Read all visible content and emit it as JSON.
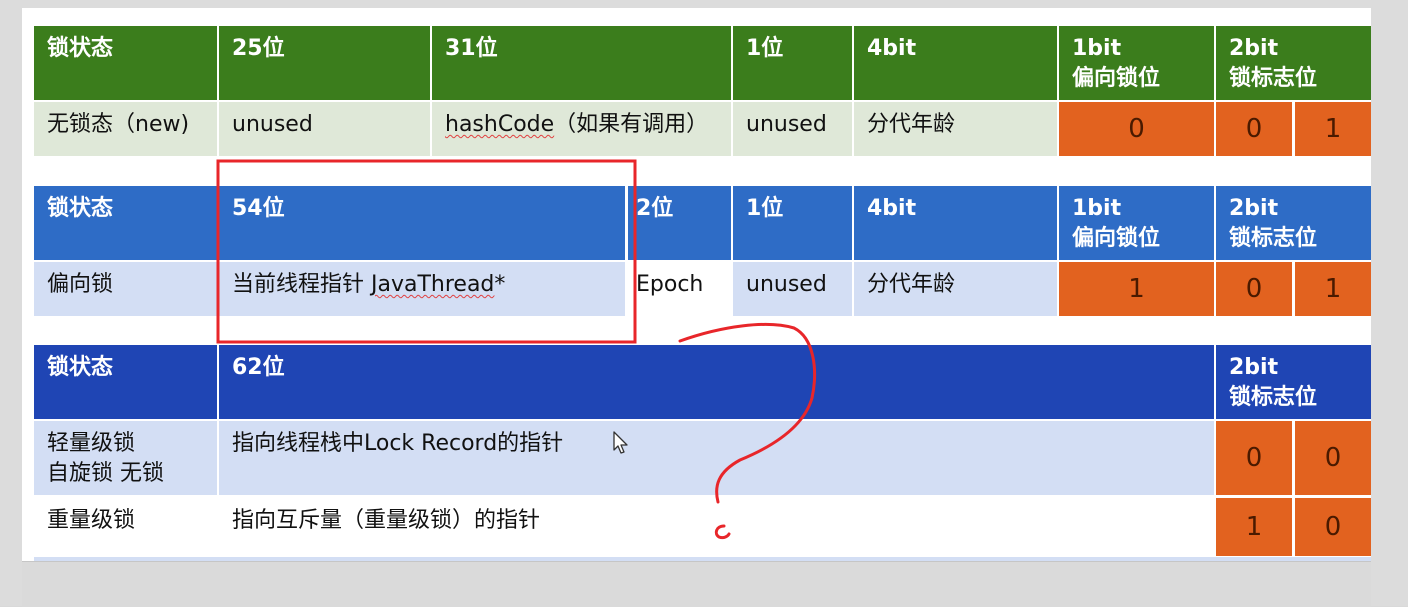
{
  "table1": {
    "header": [
      "锁状态",
      "25位",
      "31位",
      "1位",
      "4bit",
      "1bit\n偏向锁位",
      "2bit\n锁标志位"
    ],
    "row": {
      "state": "无锁态（new)",
      "c1": "unused",
      "c2_code": "hashCode",
      "c2_rest": "（如果有调用）",
      "c3": "unused",
      "c4": "分代年龄",
      "biased": "0",
      "flag1": "0",
      "flag2": "1"
    }
  },
  "table2": {
    "header": [
      "锁状态",
      "54位",
      "2位",
      "1位",
      "4bit",
      "1bit\n偏向锁位",
      "2bit\n锁标志位"
    ],
    "row": {
      "state": "偏向锁",
      "c1_pre": "当前线程指针 ",
      "c1_code": "JavaThread",
      "c1_post": "*",
      "c2": "Epoch",
      "c3": "unused",
      "c4": "分代年龄",
      "biased": "1",
      "flag1": "0",
      "flag2": "1"
    }
  },
  "table3": {
    "header": [
      "锁状态",
      "62位",
      "2bit\n锁标志位"
    ],
    "rows": [
      {
        "state": "轻量级锁\n自旋锁 无锁",
        "desc": "指向线程栈中Lock Record的指针",
        "flag1": "0",
        "flag2": "0"
      },
      {
        "state": "重量级锁",
        "desc": "指向互斥量（重量级锁）的指针",
        "flag1": "1",
        "flag2": "0"
      }
    ]
  },
  "colors": {
    "header_green": "#3b7d1c",
    "header_blue": "#2e6cc6",
    "header_navy": "#1f45b4",
    "bit_orange": "#e2621f",
    "annotation_red": "#e8262a"
  }
}
